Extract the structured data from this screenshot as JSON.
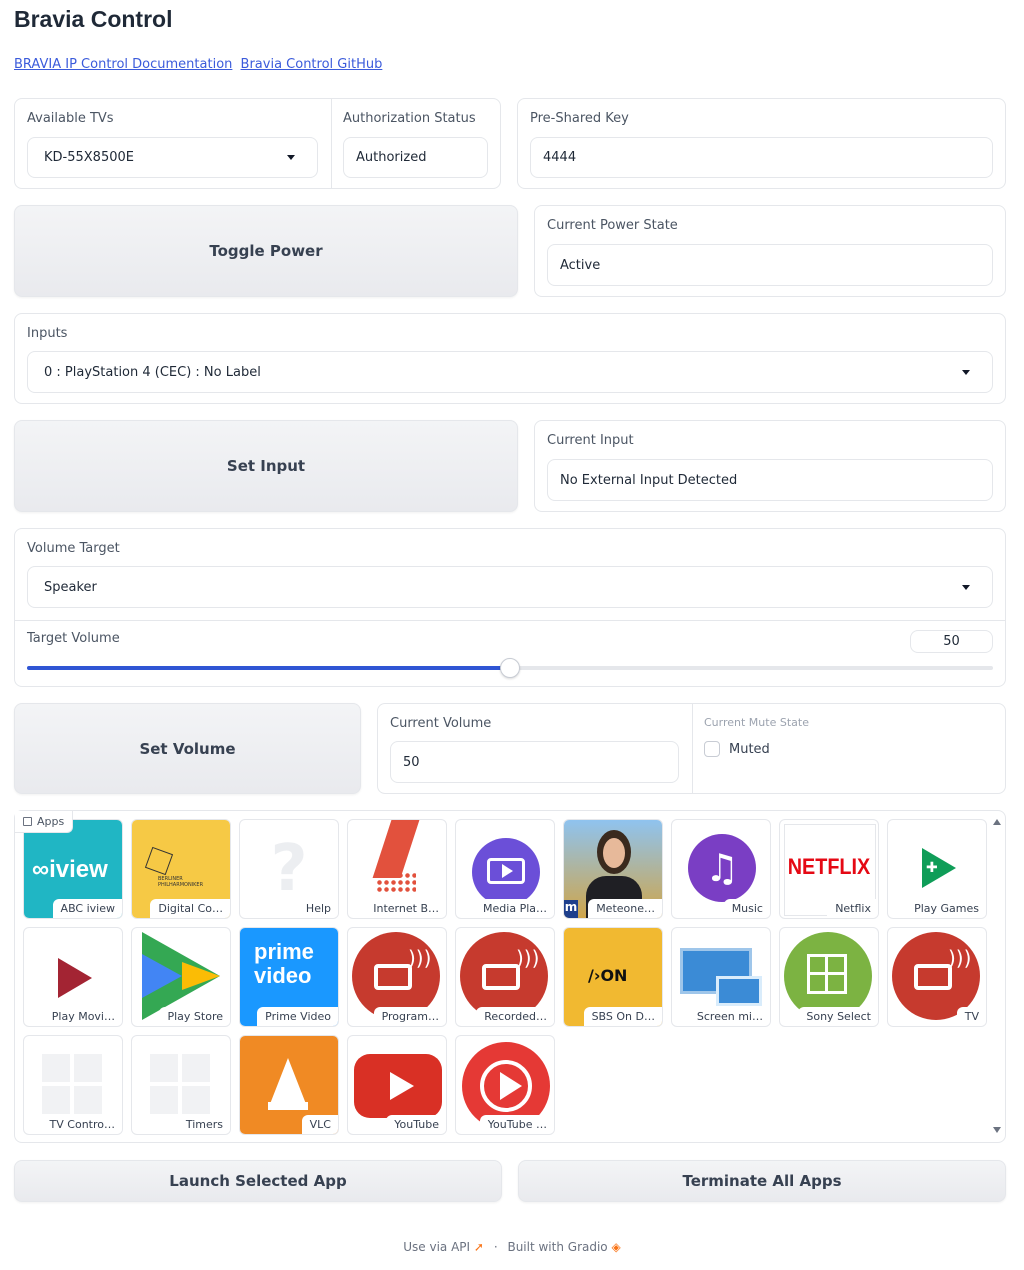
{
  "app": {
    "title": "Bravia Control",
    "links": [
      "BRAVIA IP Control Documentation",
      "Bravia Control GitHub"
    ]
  },
  "tv_select": {
    "label": "Available TVs",
    "value": "KD-55X8500E"
  },
  "auth": {
    "label": "Authorization Status",
    "value": "Authorized"
  },
  "psk": {
    "label": "Pre-Shared Key",
    "value": "4444"
  },
  "power": {
    "button": "Toggle Power",
    "label": "Current Power State",
    "value": "Active"
  },
  "inputs": {
    "label": "Inputs",
    "value": "0 : PlayStation 4 (CEC) : No Label"
  },
  "set_input": {
    "button": "Set Input",
    "label": "Current Input",
    "value": "No External Input Detected"
  },
  "volume": {
    "target_label": "Volume Target",
    "target_value": "Speaker",
    "slider_label": "Target Volume",
    "slider_value": "50",
    "slider_fraction": 0.5,
    "button": "Set Volume",
    "current_label": "Current Volume",
    "current_value": "50",
    "mute_label": "Current Mute State",
    "mute_checkbox": "Muted",
    "muted": false
  },
  "apps": {
    "label": "Apps",
    "items": [
      {
        "name": "ABC iview",
        "icon": "abc-iview-logo"
      },
      {
        "name": "Digital Co…",
        "icon": "berliner-philharmoniker-logo"
      },
      {
        "name": "Help",
        "icon": "question-mark-icon"
      },
      {
        "name": "Internet B…",
        "icon": "internet-browser-icon"
      },
      {
        "name": "Media Pla…",
        "icon": "media-player-icon"
      },
      {
        "name": "Meteone…",
        "icon": "weather-presenter-photo"
      },
      {
        "name": "Music",
        "icon": "music-note-icon"
      },
      {
        "name": "Netflix",
        "icon": "netflix-logo"
      },
      {
        "name": "Play Games",
        "icon": "play-games-icon"
      },
      {
        "name": "Play Movi…",
        "icon": "play-movies-icon"
      },
      {
        "name": "Play Store",
        "icon": "play-store-icon"
      },
      {
        "name": "Prime Video",
        "icon": "prime-video-logo"
      },
      {
        "name": "Program…",
        "icon": "tv-cast-icon"
      },
      {
        "name": "Recorded…",
        "icon": "tv-cast-icon"
      },
      {
        "name": "SBS On D…",
        "icon": "sbs-on-demand-logo"
      },
      {
        "name": "Screen mi…",
        "icon": "screen-mirroring-icon"
      },
      {
        "name": "Sony Select",
        "icon": "sony-select-icon"
      },
      {
        "name": "TV",
        "icon": "tv-cast-icon"
      },
      {
        "name": "TV Contro…",
        "icon": "grid-placeholder-icon"
      },
      {
        "name": "Timers",
        "icon": "grid-placeholder-icon"
      },
      {
        "name": "VLC",
        "icon": "vlc-cone-icon"
      },
      {
        "name": "YouTube",
        "icon": "youtube-logo"
      },
      {
        "name": "YouTube …",
        "icon": "youtube-music-logo"
      }
    ]
  },
  "actions": {
    "launch": "Launch Selected App",
    "terminate": "Terminate All Apps"
  },
  "footer": {
    "api": "Use via API",
    "sep": "·",
    "built": "Built with Gradio"
  },
  "colors": {
    "accent": "#2f55d4",
    "netflix": "#e50914",
    "youtube": "#d93025"
  }
}
